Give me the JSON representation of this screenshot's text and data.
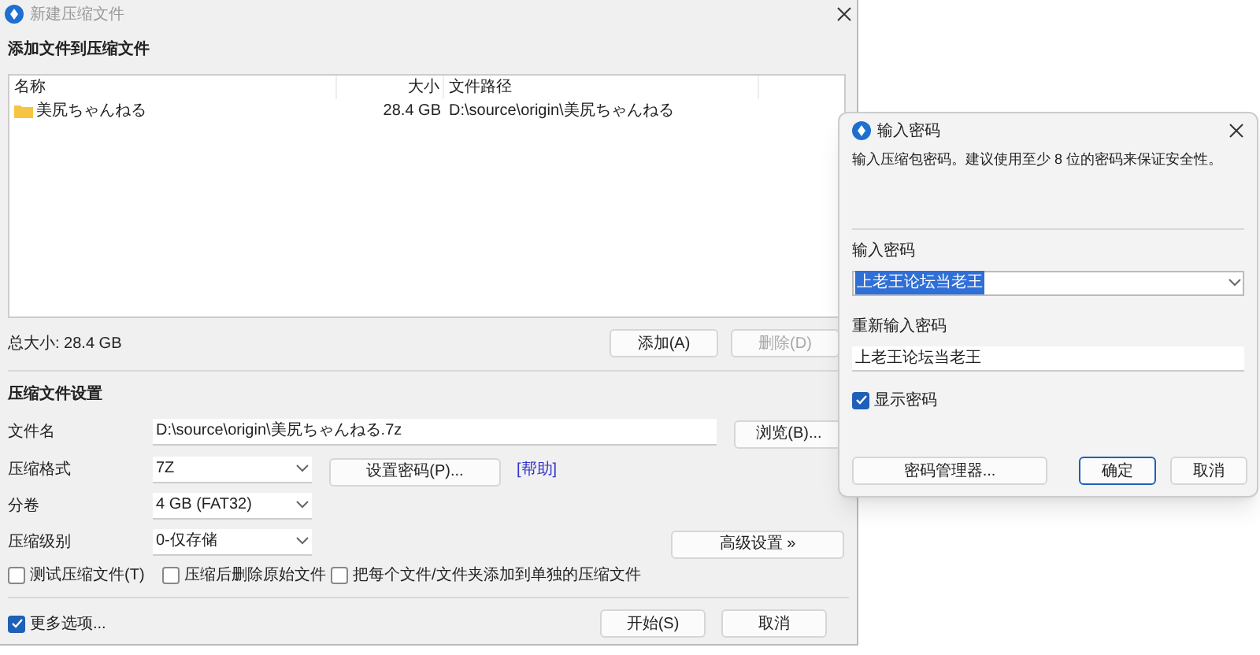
{
  "main_window": {
    "title": "新建压缩文件",
    "add_section": {
      "heading": "添加文件到压缩文件",
      "table": {
        "columns": [
          "名称",
          "大小",
          "文件路径"
        ],
        "rows": [
          {
            "name": "美尻ちゃんねる",
            "size": "28.4 GB",
            "path": "D:\\source\\origin\\美尻ちゃんねる"
          }
        ]
      },
      "total": "总大小: 28.4 GB",
      "buttons": [
        {
          "label": "添加(A)",
          "disabled": false
        },
        {
          "label": "删除(D)",
          "disabled": true
        }
      ]
    },
    "settings": {
      "heading": "压缩文件设置",
      "filename": {
        "label": "文件名",
        "value": "D:\\source\\origin\\美尻ちゃんねる.7z",
        "button": "浏览(B)..."
      },
      "format": {
        "label": "压缩格式",
        "value": "7Z",
        "button": "设置密码(P)...",
        "link": "[帮助]"
      },
      "volume": {
        "label": "分卷",
        "value": "4 GB (FAT32)"
      },
      "level": {
        "label": "压缩级别",
        "value": "0-仅存储",
        "button": "高级设置 »"
      },
      "options": [
        {
          "label": "测试压缩文件(T)",
          "checked": false
        },
        {
          "label": "压缩后删除原始文件",
          "checked": false
        },
        {
          "label": "把每个文件/文件夹添加到单独的压缩文件",
          "checked": false
        }
      ]
    },
    "more_options": {
      "label": "更多选项...",
      "checked": true
    },
    "buttons": [
      "开始(S)",
      "取消"
    ]
  },
  "password_dialog": {
    "title": "输入密码",
    "message": "输入压缩包密码。建议使用至少 8 位的密码来保证安全性。",
    "password_label": "输入密码",
    "password_value": "上老王论坛当老王",
    "confirm_label": "重新输入密码",
    "confirm_value": "上老王论坛当老王",
    "show_password": {
      "label": "显示密码",
      "checked": true
    },
    "buttons": [
      {
        "label": "密码管理器...",
        "focused": false
      },
      {
        "label": "确定",
        "focused": true
      },
      {
        "label": "取消",
        "focused": false
      }
    ]
  }
}
